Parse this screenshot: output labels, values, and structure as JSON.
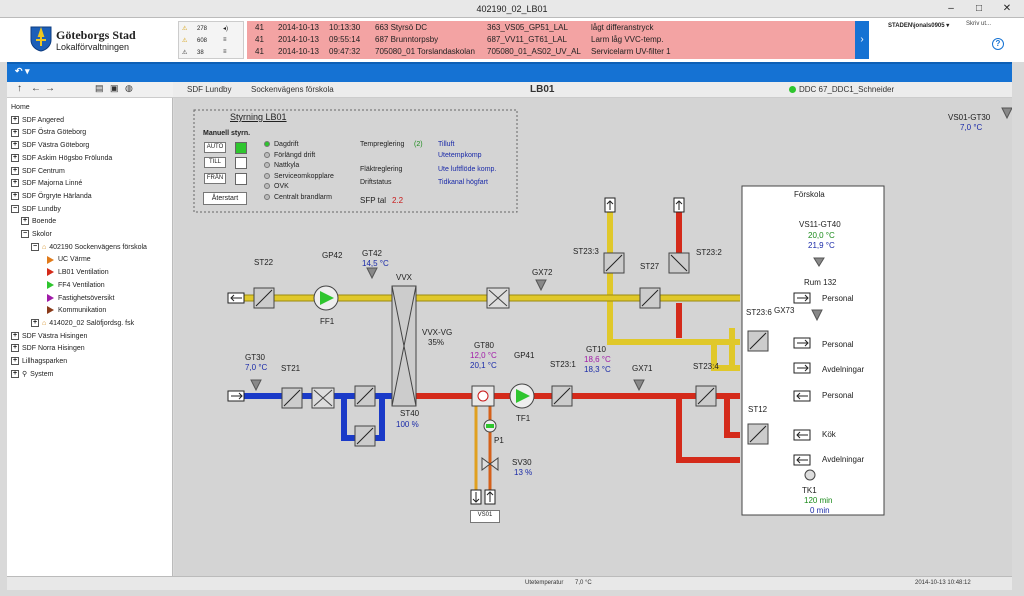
{
  "window": {
    "title": "402190_02_LB01"
  },
  "header": {
    "org_line1": "Göteborgs Stad",
    "org_line2": "Lokalförvaltningen",
    "counts": [
      "278",
      "608",
      "38"
    ],
    "user": "STADEN\\jonals0905",
    "search_placeholder": "Skriv ut..."
  },
  "alarms": [
    {
      "prio": "41",
      "date": "2014-10-13",
      "time": "10:13:30",
      "site": "663 Styrsö DC",
      "point": "363_VS05_GP51_LAL",
      "text": "lågt differanstryck"
    },
    {
      "prio": "41",
      "date": "2014-10-13",
      "time": "09:55:14",
      "site": "687 Brunntorpsby",
      "point": "687_VV11_GT61_LAL",
      "text": "Larm låg VVC-temp."
    },
    {
      "prio": "41",
      "date": "2014-10-13",
      "time": "09:47:32",
      "site": "705080_01 Torslandaskolan",
      "point": "705080_01_AS02_UV_AL",
      "text": "Servicelarm UV-filter 1"
    }
  ],
  "breadcrumb": {
    "area": "SDF Lundby",
    "site": "Sockenvägens förskola",
    "page": "LB01",
    "controller": "DDC 67_DDC1_Schneider"
  },
  "tree": [
    {
      "label": "Home",
      "level": 0,
      "kind": "none"
    },
    {
      "label": "SDF Angered",
      "level": 0,
      "kind": "plus"
    },
    {
      "label": "SDF Östra Göteborg",
      "level": 0,
      "kind": "plus"
    },
    {
      "label": "SDF Västra Göteborg",
      "level": 0,
      "kind": "plus"
    },
    {
      "label": "SDF Askim Högsbo Frölunda",
      "level": 0,
      "kind": "plus"
    },
    {
      "label": "SDF Centrum",
      "level": 0,
      "kind": "plus"
    },
    {
      "label": "SDF Majorna Linné",
      "level": 0,
      "kind": "plus"
    },
    {
      "label": "SDF Örgryte Härlanda",
      "level": 0,
      "kind": "plus"
    },
    {
      "label": "SDF Lundby",
      "level": 0,
      "kind": "minus"
    },
    {
      "label": "Boende",
      "level": 1,
      "kind": "plus"
    },
    {
      "label": "Skolor",
      "level": 1,
      "kind": "minus"
    },
    {
      "label": "402190 Sockenvägens förskola",
      "level": 2,
      "kind": "minus-house"
    },
    {
      "label": "UC Värme",
      "level": 3,
      "kind": "tri-orange"
    },
    {
      "label": "LB01 Ventilation",
      "level": 3,
      "kind": "tri-red"
    },
    {
      "label": "FF4 Ventilation",
      "level": 3,
      "kind": "tri-green"
    },
    {
      "label": "Fastighetsöversikt",
      "level": 3,
      "kind": "tri-purple"
    },
    {
      "label": "Kommunikation",
      "level": 3,
      "kind": "tri-brown"
    },
    {
      "label": "414020_02 Salöfjordsg. fsk",
      "level": 2,
      "kind": "plus-house"
    },
    {
      "label": "SDF Västra Hisingen",
      "level": 0,
      "kind": "plus"
    },
    {
      "label": "SDF Norra Hisingen",
      "level": 0,
      "kind": "plus"
    },
    {
      "label": "Lillhagsparken",
      "level": 0,
      "kind": "plus"
    },
    {
      "label": "System",
      "level": 0,
      "kind": "plus-search"
    }
  ],
  "control": {
    "title": "Styrning LB01",
    "manual_label": "Manuell styrn.",
    "auto": "AUTO",
    "till": "TILL",
    "fran": "FRÅN",
    "restart": "Återstart",
    "modes": [
      {
        "label": "Dagdrift",
        "on": true
      },
      {
        "label": "Förlängd drift",
        "on": false
      },
      {
        "label": "Nattkyla",
        "on": false
      },
      {
        "label": "Serviceomkopplare",
        "on": false
      },
      {
        "label": "OVK",
        "on": false
      },
      {
        "label": "Centralt brandlarm",
        "on": false
      }
    ],
    "temp_reg_label": "Tempreglering",
    "temp_reg_num": "(2)",
    "temp_reg_val1": "Tilluft",
    "temp_reg_val2": "Utetempkomp",
    "flakt_label": "Fläktreglering",
    "flakt_val": "Ute luftflöde komp.",
    "drift_label": "Driftstatus",
    "drift_val": "Tidkanal högfart",
    "sfp_label": "SFP tal",
    "sfp_val": "2.2"
  },
  "diagram": {
    "vs01_gt30": {
      "name": "VS01-GT30",
      "val": "7,0 °C"
    },
    "forskola": "Förskola",
    "vs11_gt40": {
      "name": "VS11-GT40",
      "val1": "20,0 °C",
      "val2": "21,9 °C",
      "room": "Rum 132"
    },
    "st22": "ST22",
    "gp42": "GP42",
    "gt42": {
      "name": "GT42",
      "val": "14,5 °C"
    },
    "vvx": "VVX",
    "gx72": "GX72",
    "ff1": "FF1",
    "st23_3": "ST23:3",
    "st27": "ST27",
    "st23_2": "ST23:2",
    "vvx_vg": {
      "name": "VVX-VG",
      "val": "35%"
    },
    "gt30": {
      "name": "GT30",
      "val": "7,0 °C"
    },
    "st21": "ST21",
    "st40": {
      "name": "ST40",
      "val": "100 %"
    },
    "gt80": {
      "name": "GT80",
      "val1": "12,0 °C",
      "val2": "20,1 °C"
    },
    "gp41": "GP41",
    "tf1": "TF1",
    "st23_1": "ST23:1",
    "gt10": {
      "name": "GT10",
      "val1": "18,6 °C",
      "val2": "18,3 °C"
    },
    "gx71": "GX71",
    "st23_4": "ST23:4",
    "st23_6": "ST23:6",
    "gx73": "GX73",
    "st12": "ST12",
    "p1": "P1",
    "sv30": {
      "name": "SV30",
      "val": "13 %"
    },
    "vs01": "VS01",
    "rooms": [
      "Personal",
      "Personal",
      "Avdelningar",
      "Personal",
      "Kök",
      "Avdelningar"
    ],
    "tk1": {
      "name": "TK1",
      "val1": "120 min",
      "val2": "0 min"
    }
  },
  "footer": {
    "outdoor_label": "Utetemperatur",
    "outdoor_val": "7,0 °C",
    "timestamp": "2014-10-13 10:48:12"
  },
  "colors": {
    "accent": "#1572d3",
    "alarm_bg": "#f3a3a3",
    "supply": "#d42a1a",
    "extract": "#e0c82a",
    "outdoor": "#1a3ac8"
  }
}
